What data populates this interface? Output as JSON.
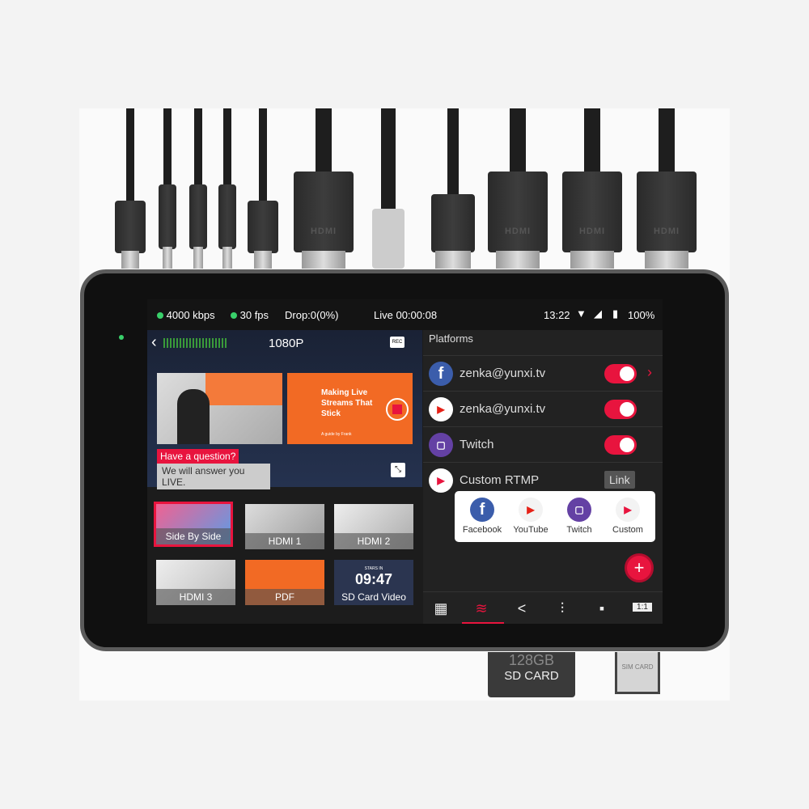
{
  "connectors": {
    "hdmi_label": "HDMI"
  },
  "status_bar": {
    "bitrate": "4000 kbps",
    "fps": "30 fps",
    "drop": "Drop:0(0%)",
    "live": "Live 00:00:08",
    "time": "13:22",
    "battery": "100%"
  },
  "preview": {
    "resolution": "1080P",
    "slide_title": "Making Live Streams That Stick",
    "slide_sub": "A guide by Frank",
    "lower_third_1": "Have a question?",
    "lower_third_2": "We will answer you LIVE."
  },
  "scenes": [
    {
      "label": "Side By Side",
      "selected": true
    },
    {
      "label": "HDMI 1"
    },
    {
      "label": "HDMI 2"
    },
    {
      "label": "HDMI 3"
    },
    {
      "label": "PDF"
    },
    {
      "label": "SD Card Video",
      "timer": "09:47",
      "timer_caption": "STARS IN"
    }
  ],
  "platforms": {
    "title": "Platforms",
    "items": [
      {
        "icon": "facebook-icon",
        "label": "zenka@yunxi.tv",
        "enabled": true
      },
      {
        "icon": "youtube-icon",
        "label": "zenka@yunxi.tv",
        "enabled": true
      },
      {
        "icon": "twitch-icon",
        "label": "Twitch",
        "enabled": true
      },
      {
        "icon": "custom-rtmp-icon",
        "label": "Custom RTMP",
        "action": "Link"
      }
    ],
    "add_menu": [
      "Facebook",
      "YouTube",
      "Twitch",
      "Custom"
    ]
  },
  "nav": [
    "layout",
    "layers",
    "share",
    "mixer",
    "comments",
    "aspect-ratio"
  ],
  "nav_aspect_label": "1:1",
  "sd_card": {
    "capacity": "128GB",
    "label": "SD CARD"
  },
  "sim_card": {
    "label": "SIM CARD"
  },
  "colors": {
    "accent": "#e8143e",
    "facebook": "#3b5dab",
    "youtube": "#e62117",
    "twitch": "#6441a4",
    "live_dot": "#39d06a"
  }
}
